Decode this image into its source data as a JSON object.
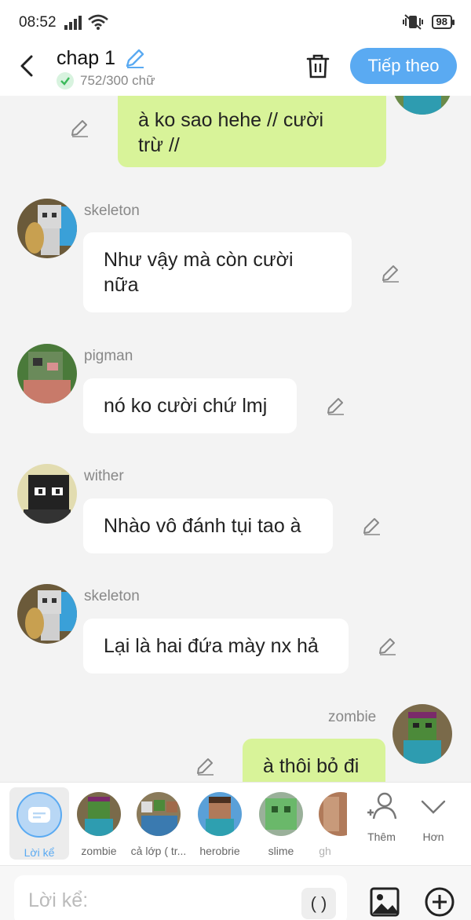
{
  "status": {
    "time": "08:52",
    "battery": "98"
  },
  "header": {
    "title": "chap 1",
    "word_count": "752/300 chữ",
    "next_label": "Tiếp theo"
  },
  "messages": [
    {
      "side": "right",
      "sender": "",
      "text": "à ko sao hehe // cười\ntrừ //"
    },
    {
      "side": "left",
      "sender": "skeleton",
      "text": "Như vậy mà còn cười\nnữa"
    },
    {
      "side": "left",
      "sender": "pigman",
      "text": "nó ko cười chứ lmj"
    },
    {
      "side": "left",
      "sender": "wither",
      "text": "Nhào vô đánh tụi tao à"
    },
    {
      "side": "left",
      "sender": "skeleton",
      "text": "Lại là hai đứa mày nx hả"
    },
    {
      "side": "right",
      "sender": "zombie",
      "text": "à thôi bỏ đi"
    }
  ],
  "characters": {
    "narrator": "Lời kể",
    "list": [
      "zombie",
      "cả lớp ( tr...",
      "herobrie",
      "slime",
      "gh"
    ],
    "add_label": "Thêm",
    "more_label": "Hơn"
  },
  "input": {
    "placeholder": "Lời kể:",
    "paren_label": "( )"
  },
  "colors": {
    "accent": "#5aaaf2",
    "right_bubble": "#d8f399",
    "left_bubble": "#ffffff",
    "background": "#f3f3f3"
  }
}
